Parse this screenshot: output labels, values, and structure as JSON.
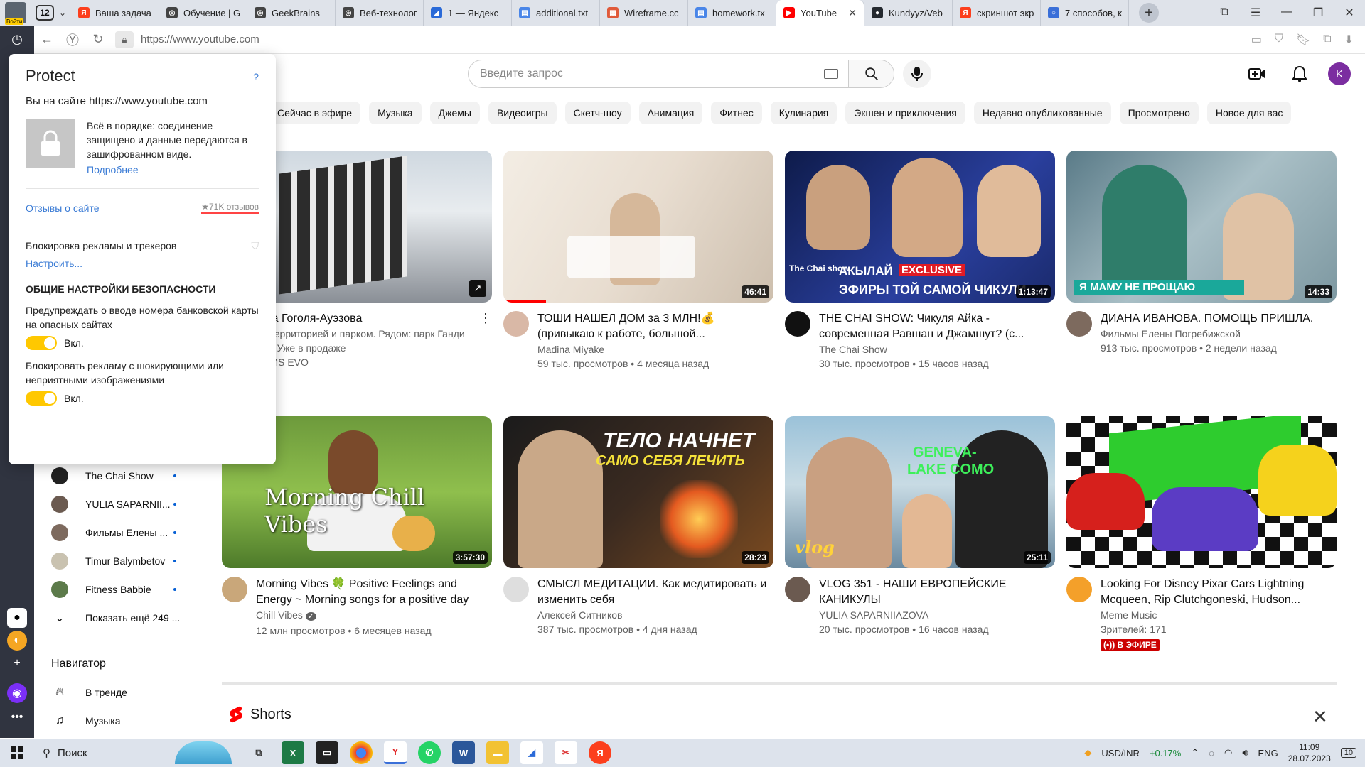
{
  "browser": {
    "tab_count": "12",
    "login_badge": "Войти",
    "tabs": [
      {
        "label": "Ваша задача",
        "color": "#fc3f1d",
        "glyph": "Я"
      },
      {
        "label": "Обучение | G",
        "color": "#444444",
        "glyph": "◎"
      },
      {
        "label": "GeekBrains",
        "color": "#444444",
        "glyph": "◎"
      },
      {
        "label": "Веб-технолог",
        "color": "#444444",
        "glyph": "◎"
      },
      {
        "label": "1 — Яндекс",
        "color": "#2a6ad8",
        "glyph": "◢"
      },
      {
        "label": "additional.txt",
        "color": "#4a86e8",
        "glyph": "▤"
      },
      {
        "label": "Wireframe.cc",
        "color": "#e05a3a",
        "glyph": "▦"
      },
      {
        "label": "homework.tx",
        "color": "#4a86e8",
        "glyph": "▤"
      },
      {
        "label": "YouTube",
        "color": "#ff0000",
        "glyph": "▶",
        "active": true
      },
      {
        "label": "Kundyyz/Veb",
        "color": "#24292f",
        "glyph": "●"
      },
      {
        "label": "скриншот экр",
        "color": "#fc3f1d",
        "glyph": "Я"
      },
      {
        "label": "7 способов, к",
        "color": "#3a6fd8",
        "glyph": "○"
      }
    ],
    "url": "https://www.youtube.com"
  },
  "youtube": {
    "search_placeholder": "Введите запрос",
    "user_initial": "K",
    "chips": [
      "Сейчас в эфире",
      "Музыка",
      "Джемы",
      "Видеоигры",
      "Скетч-шоу",
      "Анимация",
      "Фитнес",
      "Кулинария",
      "Экшен и приключения",
      "Недавно опубликованные",
      "Просмотрено",
      "Новое для вас"
    ],
    "sidebar": {
      "subscriptions": [
        {
          "name": "The Chai Show",
          "color": "#222222"
        },
        {
          "name": "YULIA SAPARNII...",
          "color": "#6b5a50"
        },
        {
          "name": "Фильмы Елены ...",
          "color": "#7d6a5e"
        },
        {
          "name": "Timur Balymbetov",
          "color": "#c9c2b0"
        },
        {
          "name": "Fitness Babbie",
          "color": "#5c7a4a"
        }
      ],
      "show_more": "Показать ещё 249 ...",
      "navigator_title": "Навигатор",
      "nav_items": [
        {
          "label": "В тренде",
          "icon": "trending-icon"
        },
        {
          "label": "Музыка",
          "icon": "music-icon"
        }
      ]
    },
    "videos_row1": [
      {
        "title": "К на Гоголя-Ауэзова",
        "line2": "ой территорией и парком. Рядом: парк Ганди",
        "line3": "тай. Уже в продаже",
        "channel": "RAMS EVO",
        "duration": "",
        "views": ""
      },
      {
        "title": "ТОШИ НАШЕЛ ДОМ за 3 МЛН!💰 (привыкаю к работе, большой...",
        "channel": "Madina Miyake",
        "views": "59 тыс. просмотров • 4 месяца назад",
        "duration": "46:41"
      },
      {
        "title": "THE CHAI SHOW: Чикуля Айка - современная Равшан и Джамшут? (с...",
        "channel": "The Chai Show",
        "views": "30 тыс. просмотров • 15 часов назад",
        "duration": "1:13:47",
        "caption1": "АКЫЛАЙ",
        "caption2": "EXCLUSIVE",
        "caption3": "ЭФИРЫ ТОЙ САМОЙ ЧИКУЛИ",
        "logo": "The Chai show"
      },
      {
        "title": "ДИАНА ИВАНОВА. ПОМОЩЬ ПРИШЛА.",
        "channel": "Фильмы Елены Погребижской",
        "views": "913 тыс. просмотров • 2 недели назад",
        "duration": "14:33",
        "caption": "Я МАМУ НЕ ПРОЩАЮ"
      }
    ],
    "videos_row2": [
      {
        "title": "Morning Vibes 🍀 Positive Feelings and Energy ~ Morning songs for a positive day",
        "channel": "Chill Vibes",
        "views": "12 млн просмотров • 6 месяцев назад",
        "duration": "3:57:30",
        "caption": "Morning Chill Vibes"
      },
      {
        "title": "СМЫСЛ МЕДИТАЦИИ. Как медитировать и изменить себя",
        "channel": "Алексей Ситников",
        "views": "387 тыс. просмотров • 4 дня назад",
        "duration": "28:23",
        "caption1": "ТЕЛО НАЧНЕТ",
        "caption2": "САМО СЕБЯ ЛЕЧИТЬ"
      },
      {
        "title": "VLOG 351 - НАШИ ЕВРОПЕЙСКИЕ КАНИКУЛЫ",
        "channel": "YULIA SAPARNIIAZOVA",
        "views": "20 тыс. просмотров • 16 часов назад",
        "duration": "25:11",
        "caption1": "GENEVA-",
        "caption2": "LAKE COMO",
        "caption3": "vlog"
      },
      {
        "title": "Looking For Disney Pixar Cars Lightning Mcqueen, Rip Clutchgoneski, Hudson...",
        "channel": "Meme Music",
        "views": "Зрителей: 171",
        "duration": "",
        "live": "(•)) В ЭФИРЕ"
      }
    ],
    "shorts_title": "Shorts"
  },
  "protect": {
    "title": "Protect",
    "help": "?",
    "site_line": "Вы на сайте https://www.youtube.com",
    "status_text": "Всё в порядке: соединение защищено и данные передаются в зашифрованном виде.",
    "more_link": "Подробнее",
    "reviews_link": "Отзывы о сайте",
    "reviews_count": "★71K отзывов",
    "block_label": "Блокировка рекламы и трекеров",
    "configure_link": "Настроить...",
    "general_heading": "ОБЩИЕ НАСТРОЙКИ БЕЗОПАСНОСТИ",
    "opt1": "Предупреждать о вводе номера банковской карты на опасных сайтах",
    "opt1_state": "Вкл.",
    "opt2": "Блокировать рекламу с шокирующими или неприятными изображениями",
    "opt2_state": "Вкл."
  },
  "taskbar": {
    "search_label": "Поиск",
    "ticker": "USD/INR",
    "ticker_change": "+0.17%",
    "lang": "ENG",
    "time": "11:09",
    "date": "28.07.2023",
    "notif_count": "10"
  }
}
